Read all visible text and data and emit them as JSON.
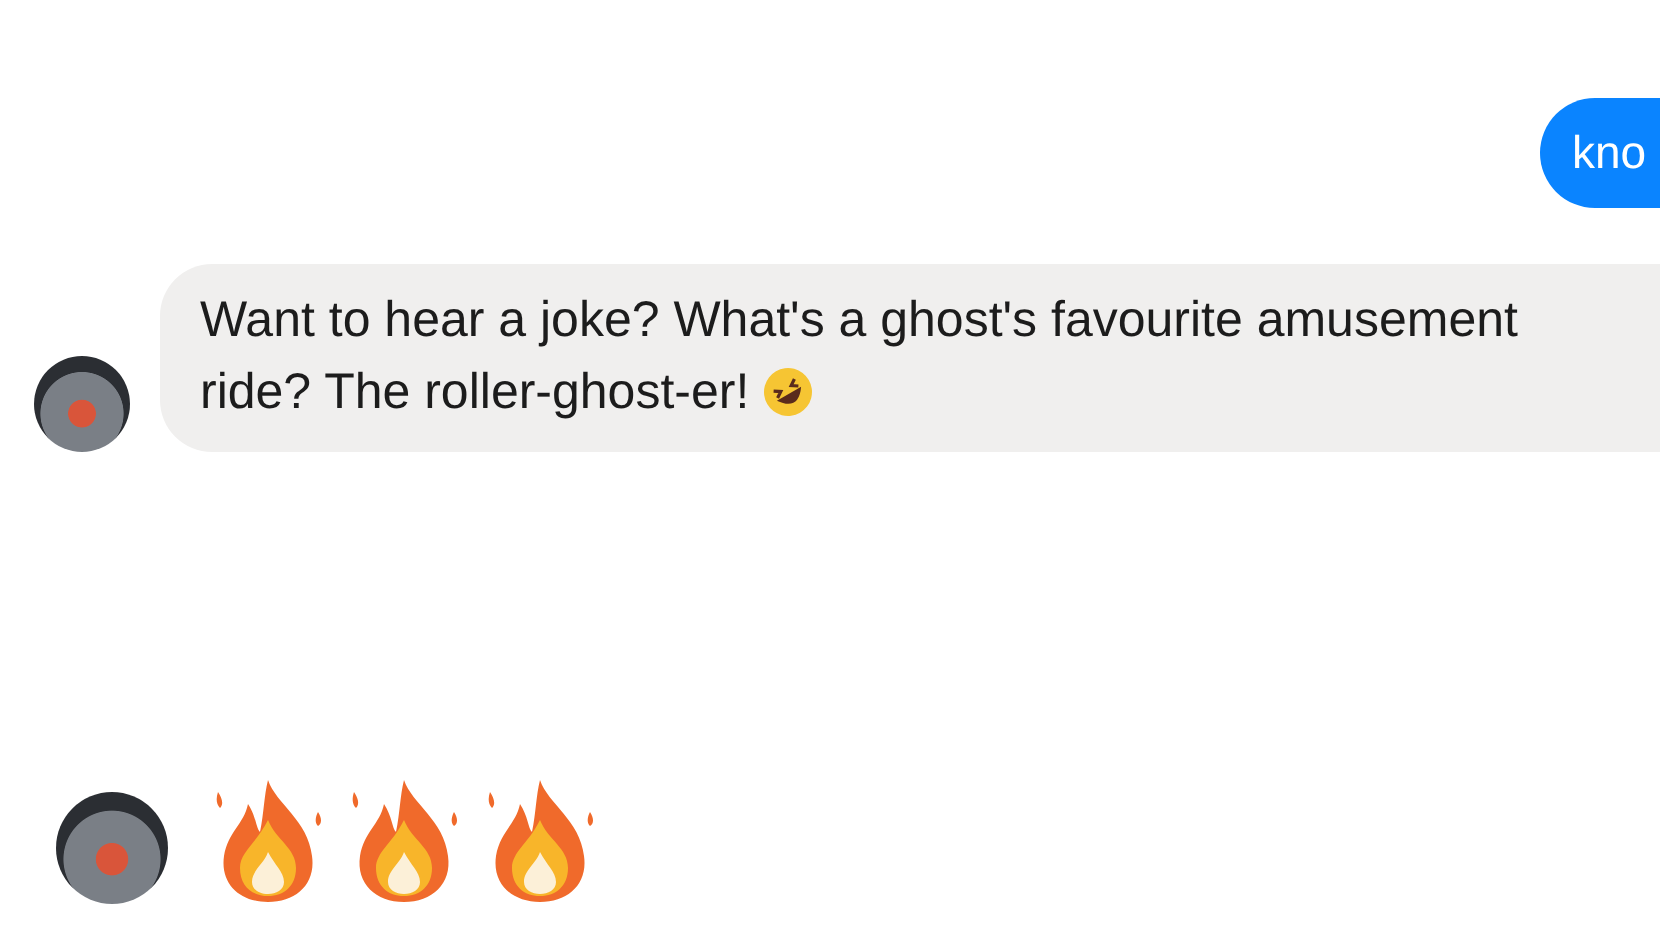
{
  "messages": [
    {
      "kind": "outgoing",
      "text": "kno"
    },
    {
      "kind": "incoming",
      "text": "Want to hear a joke? What's a ghost's favourite amusement ride? The roller-ghost-er!",
      "laughing_emoji": true
    },
    {
      "kind": "fire_emojis"
    }
  ]
}
